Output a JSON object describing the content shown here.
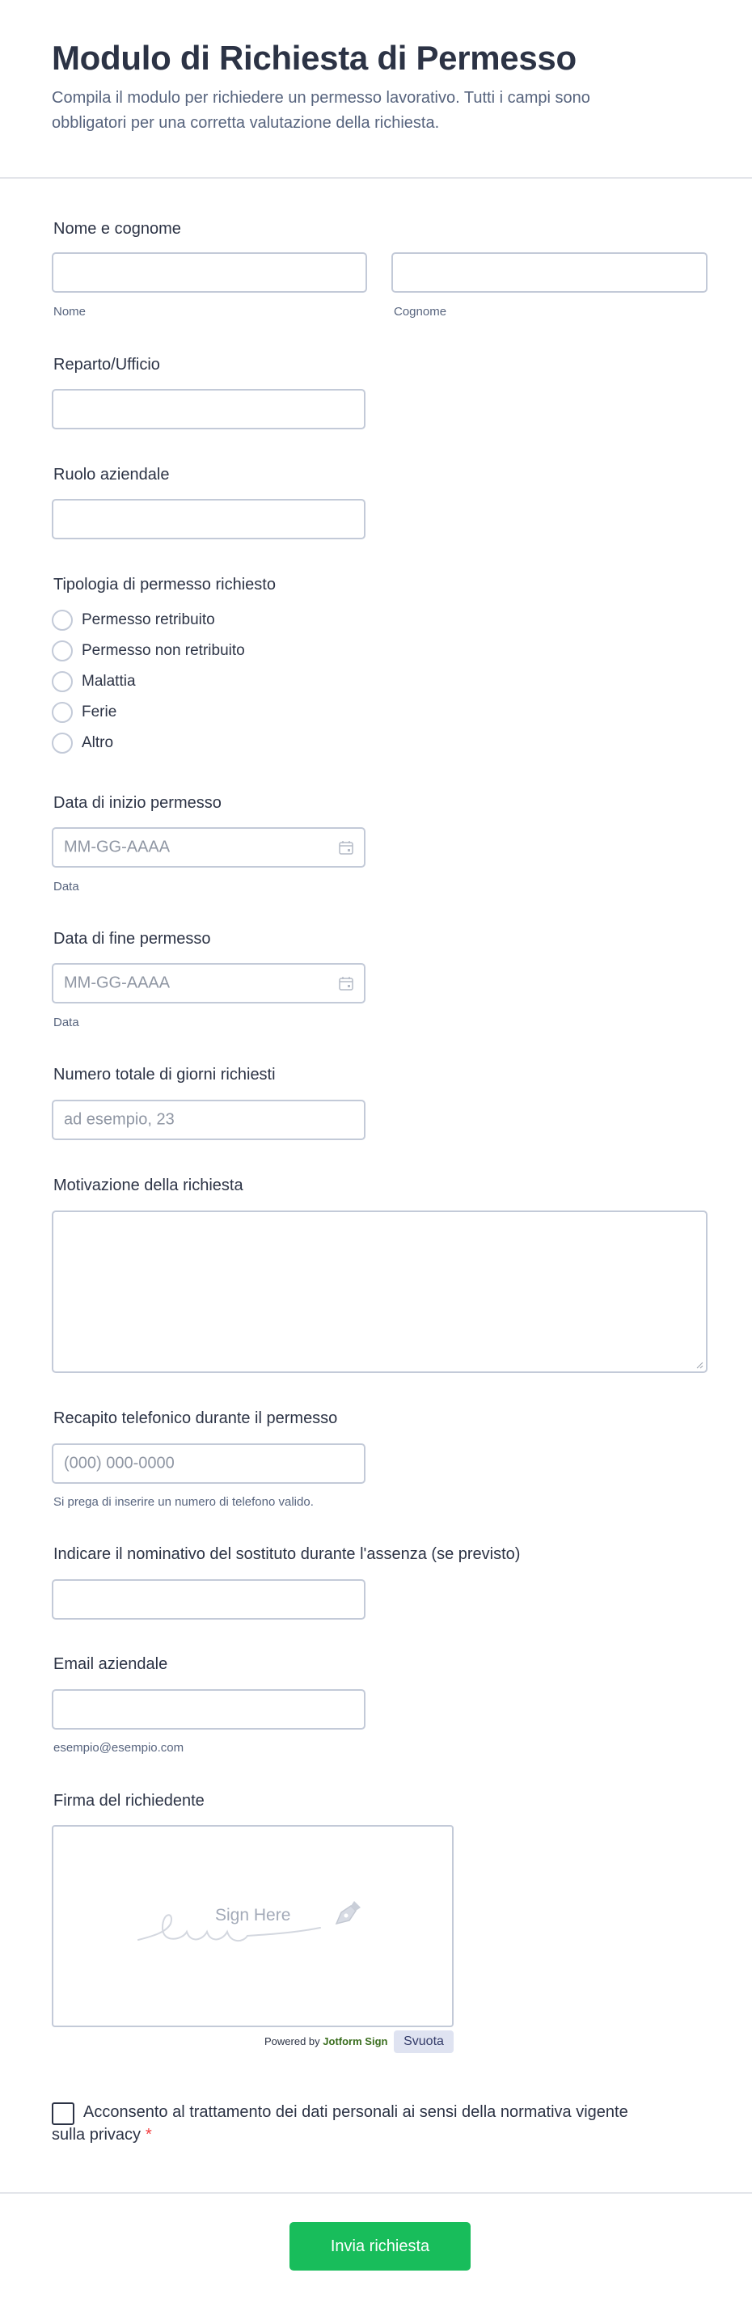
{
  "header": {
    "title": "Modulo di Richiesta di Permesso",
    "subtitle": "Compila il modulo per richiedere un permesso lavorativo. Tutti i campi sono obbligatori per una corretta valutazione della richiesta."
  },
  "fields": {
    "name": {
      "label": "Nome e cognome",
      "first_sublabel": "Nome",
      "last_sublabel": "Cognome",
      "first_value": "",
      "last_value": ""
    },
    "department": {
      "label": "Reparto/Ufficio",
      "value": ""
    },
    "role": {
      "label": "Ruolo aziendale",
      "value": ""
    },
    "leave_type": {
      "label": "Tipologia di permesso richiesto",
      "options": [
        "Permesso retribuito",
        "Permesso non retribuito",
        "Malattia",
        "Ferie",
        "Altro"
      ]
    },
    "start_date": {
      "label": "Data di inizio permesso",
      "placeholder": "MM-GG-AAAA",
      "sublabel": "Data"
    },
    "end_date": {
      "label": "Data di fine permesso",
      "placeholder": "MM-GG-AAAA",
      "sublabel": "Data"
    },
    "total_days": {
      "label": "Numero totale di giorni richiesti",
      "placeholder": "ad esempio, 23"
    },
    "reason": {
      "label": "Motivazione della richiesta",
      "value": ""
    },
    "phone": {
      "label": "Recapito telefonico durante il permesso",
      "placeholder": "(000) 000-0000",
      "sublabel": "Si prega di inserire un numero di telefono valido."
    },
    "substitute": {
      "label": "Indicare il nominativo del sostituto durante l'assenza (se previsto)",
      "value": ""
    },
    "email": {
      "label": "Email aziendale",
      "sublabel": "esempio@esempio.com",
      "value": ""
    },
    "signature": {
      "label": "Firma del richiedente",
      "hint": "Sign Here",
      "powered_prefix": "Powered by",
      "powered_brand": "Jotform Sign",
      "clear_label": "Svuota"
    },
    "consent": {
      "label": "Acconsento al trattamento dei dati personali ai sensi della normativa vigente sulla privacy",
      "required_mark": "*",
      "checked": false
    }
  },
  "footer": {
    "submit_label": "Invia richiesta"
  },
  "colors": {
    "submit": "#18bd5b",
    "text": "#2c3345",
    "muted": "#57647e",
    "border": "#c3cad8",
    "required": "#f23a3c"
  },
  "icons": {
    "date": "calendar-icon",
    "signature": "pen-nib-icon"
  }
}
